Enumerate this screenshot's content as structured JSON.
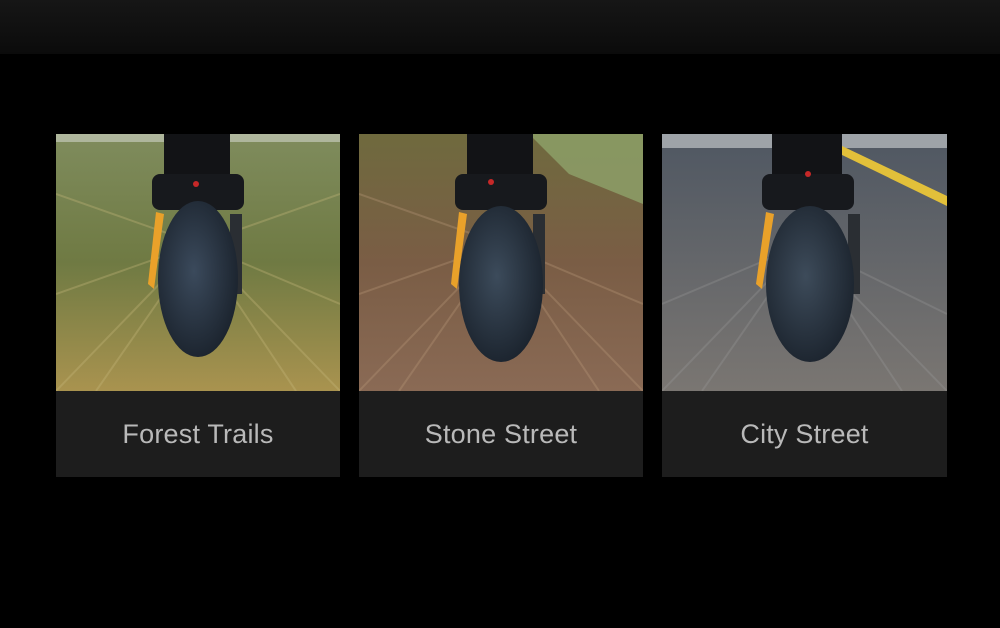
{
  "cards": [
    {
      "label": "Forest Trails"
    },
    {
      "label": "Stone Street"
    },
    {
      "label": "City Street"
    }
  ],
  "colors": {
    "background": "#000000",
    "card": "#1d1d1d",
    "caption_text": "#b9b9b9",
    "fender_accent": "#e9a12a"
  }
}
